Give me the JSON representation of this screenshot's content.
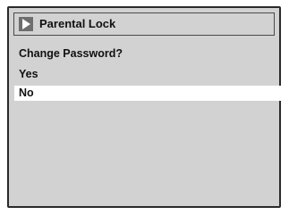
{
  "dialog": {
    "icon": "play-triangle-icon",
    "title": "Parental Lock",
    "question": "Change Password?",
    "options": [
      {
        "label": "Yes",
        "selected": false
      },
      {
        "label": "No",
        "selected": true
      }
    ]
  },
  "colors": {
    "panel_background": "#d2d2d2",
    "highlight": "#ffffff",
    "icon_background": "#6e6e6e",
    "text": "#111111"
  }
}
